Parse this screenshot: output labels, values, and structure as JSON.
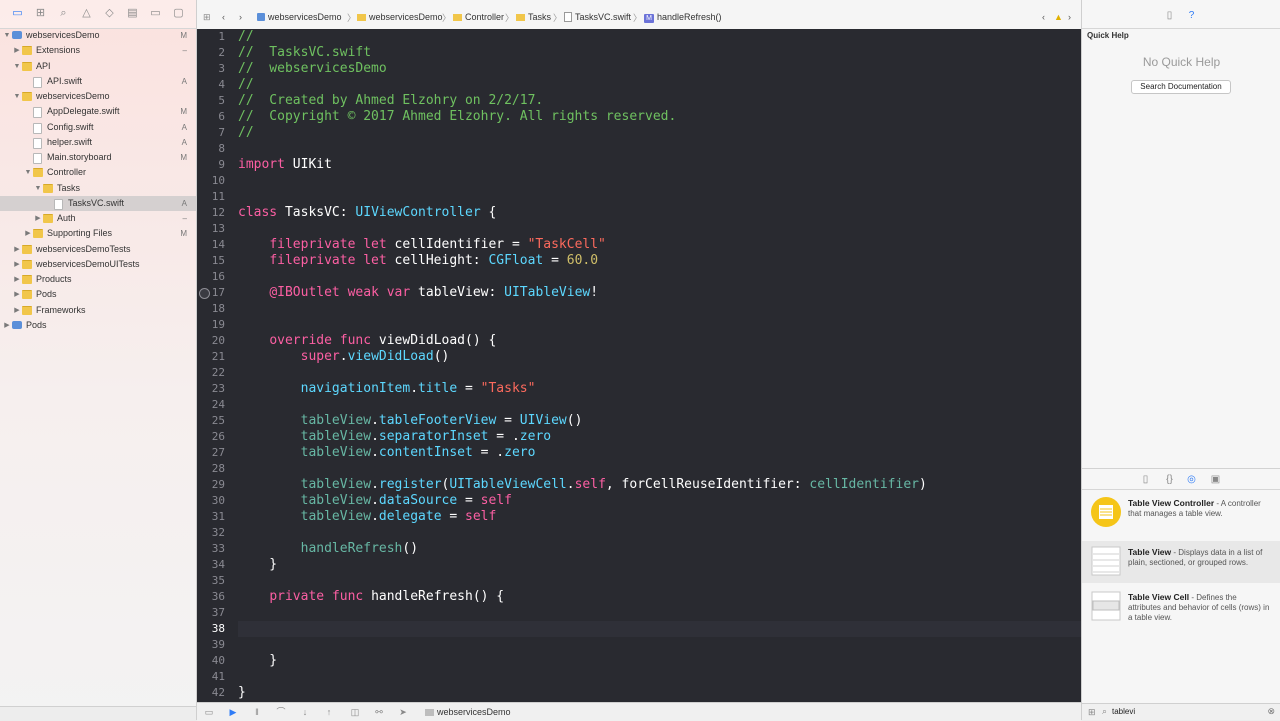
{
  "navigator": {
    "items": [
      {
        "label": "webservicesDemo",
        "level": 0,
        "expanded": true,
        "icon": "project",
        "status": "M"
      },
      {
        "label": "Extensions",
        "level": 1,
        "expanded": false,
        "icon": "folder",
        "status": "–"
      },
      {
        "label": "API",
        "level": 1,
        "expanded": true,
        "icon": "folder",
        "status": ""
      },
      {
        "label": "API.swift",
        "level": 2,
        "expanded": null,
        "icon": "file",
        "status": "A"
      },
      {
        "label": "webservicesDemo",
        "level": 1,
        "expanded": true,
        "icon": "folder",
        "status": ""
      },
      {
        "label": "AppDelegate.swift",
        "level": 2,
        "expanded": null,
        "icon": "file",
        "status": "M"
      },
      {
        "label": "Config.swift",
        "level": 2,
        "expanded": null,
        "icon": "file",
        "status": "A"
      },
      {
        "label": "helper.swift",
        "level": 2,
        "expanded": null,
        "icon": "file",
        "status": "A"
      },
      {
        "label": "Main.storyboard",
        "level": 2,
        "expanded": null,
        "icon": "file",
        "status": "M"
      },
      {
        "label": "Controller",
        "level": 2,
        "expanded": true,
        "icon": "folder",
        "status": ""
      },
      {
        "label": "Tasks",
        "level": 3,
        "expanded": true,
        "icon": "folder",
        "status": ""
      },
      {
        "label": "TasksVC.swift",
        "level": 4,
        "expanded": null,
        "icon": "file",
        "status": "A",
        "selected": true
      },
      {
        "label": "Auth",
        "level": 3,
        "expanded": false,
        "icon": "folder",
        "status": "–"
      },
      {
        "label": "Supporting Files",
        "level": 2,
        "expanded": false,
        "icon": "folder",
        "status": "M"
      },
      {
        "label": "webservicesDemoTests",
        "level": 1,
        "expanded": false,
        "icon": "folder",
        "status": ""
      },
      {
        "label": "webservicesDemoUITests",
        "level": 1,
        "expanded": false,
        "icon": "folder",
        "status": ""
      },
      {
        "label": "Products",
        "level": 1,
        "expanded": false,
        "icon": "folder",
        "status": ""
      },
      {
        "label": "Pods",
        "level": 1,
        "expanded": false,
        "icon": "folder",
        "status": ""
      },
      {
        "label": "Frameworks",
        "level": 1,
        "expanded": false,
        "icon": "folder",
        "status": ""
      },
      {
        "label": "Pods",
        "level": 0,
        "expanded": false,
        "icon": "project",
        "status": ""
      }
    ]
  },
  "jumpbar": {
    "crumbs": [
      "webservicesDemo",
      "webservicesDemo",
      "Controller",
      "Tasks",
      "TasksVC.swift",
      "handleRefresh()"
    ]
  },
  "editor": {
    "current_line": 38,
    "breakpoint_line": 17,
    "lines": [
      [
        [
          "//",
          "comment"
        ]
      ],
      [
        [
          "//  TasksVC.swift",
          "comment"
        ]
      ],
      [
        [
          "//  webservicesDemo",
          "comment"
        ]
      ],
      [
        [
          "//",
          "comment"
        ]
      ],
      [
        [
          "//  Created by Ahmed Elzohry on 2/2/17.",
          "comment"
        ]
      ],
      [
        [
          "//  Copyright © 2017 Ahmed Elzohry. All rights reserved.",
          "comment"
        ]
      ],
      [
        [
          "//",
          "comment"
        ]
      ],
      [],
      [
        [
          "import",
          "kw"
        ],
        [
          " UIKit",
          "plain"
        ]
      ],
      [],
      [],
      [
        [
          "class",
          "kw"
        ],
        [
          " TasksVC: ",
          "plain"
        ],
        [
          "UIViewController",
          "type"
        ],
        [
          " {",
          "plain"
        ]
      ],
      [],
      [
        [
          "    ",
          "plain"
        ],
        [
          "fileprivate",
          "kw"
        ],
        [
          " ",
          "plain"
        ],
        [
          "let",
          "kw"
        ],
        [
          " cellIdentifier = ",
          "plain"
        ],
        [
          "\"TaskCell\"",
          "str"
        ]
      ],
      [
        [
          "    ",
          "plain"
        ],
        [
          "fileprivate",
          "kw"
        ],
        [
          " ",
          "plain"
        ],
        [
          "let",
          "kw"
        ],
        [
          " cellHeight: ",
          "plain"
        ],
        [
          "CGFloat",
          "type"
        ],
        [
          " = ",
          "plain"
        ],
        [
          "60.0",
          "num"
        ]
      ],
      [],
      [
        [
          "    ",
          "plain"
        ],
        [
          "@IBOutlet",
          "kw"
        ],
        [
          " ",
          "plain"
        ],
        [
          "weak",
          "kw"
        ],
        [
          " ",
          "plain"
        ],
        [
          "var",
          "kw"
        ],
        [
          " tableView: ",
          "plain"
        ],
        [
          "UITableView",
          "type"
        ],
        [
          "!",
          "plain"
        ]
      ],
      [],
      [],
      [
        [
          "    ",
          "plain"
        ],
        [
          "override",
          "kw"
        ],
        [
          " ",
          "plain"
        ],
        [
          "func",
          "kw"
        ],
        [
          " viewDidLoad() {",
          "plain"
        ]
      ],
      [
        [
          "        ",
          "plain"
        ],
        [
          "super",
          "kw"
        ],
        [
          ".",
          "plain"
        ],
        [
          "viewDidLoad",
          "type"
        ],
        [
          "()",
          "plain"
        ]
      ],
      [],
      [
        [
          "        ",
          "plain"
        ],
        [
          "navigationItem",
          "type"
        ],
        [
          ".",
          "plain"
        ],
        [
          "title",
          "type"
        ],
        [
          " = ",
          "plain"
        ],
        [
          "\"Tasks\"",
          "str"
        ]
      ],
      [],
      [
        [
          "        ",
          "plain"
        ],
        [
          "tableView",
          "prop"
        ],
        [
          ".",
          "plain"
        ],
        [
          "tableFooterView",
          "type"
        ],
        [
          " = ",
          "plain"
        ],
        [
          "UIView",
          "type"
        ],
        [
          "()",
          "plain"
        ]
      ],
      [
        [
          "        ",
          "plain"
        ],
        [
          "tableView",
          "prop"
        ],
        [
          ".",
          "plain"
        ],
        [
          "separatorInset",
          "type"
        ],
        [
          " = .",
          "plain"
        ],
        [
          "zero",
          "type"
        ]
      ],
      [
        [
          "        ",
          "plain"
        ],
        [
          "tableView",
          "prop"
        ],
        [
          ".",
          "plain"
        ],
        [
          "contentInset",
          "type"
        ],
        [
          " = .",
          "plain"
        ],
        [
          "zero",
          "type"
        ]
      ],
      [],
      [
        [
          "        ",
          "plain"
        ],
        [
          "tableView",
          "prop"
        ],
        [
          ".",
          "plain"
        ],
        [
          "register",
          "type"
        ],
        [
          "(",
          "plain"
        ],
        [
          "UITableViewCell",
          "type"
        ],
        [
          ".",
          "plain"
        ],
        [
          "self",
          "kw"
        ],
        [
          ", forCellReuseIdentifier: ",
          "plain"
        ],
        [
          "cellIdentifier",
          "prop"
        ],
        [
          ")",
          "plain"
        ]
      ],
      [
        [
          "        ",
          "plain"
        ],
        [
          "tableView",
          "prop"
        ],
        [
          ".",
          "plain"
        ],
        [
          "dataSource",
          "type"
        ],
        [
          " = ",
          "plain"
        ],
        [
          "self",
          "kw"
        ]
      ],
      [
        [
          "        ",
          "plain"
        ],
        [
          "tableView",
          "prop"
        ],
        [
          ".",
          "plain"
        ],
        [
          "delegate",
          "type"
        ],
        [
          " = ",
          "plain"
        ],
        [
          "self",
          "kw"
        ]
      ],
      [],
      [
        [
          "        ",
          "plain"
        ],
        [
          "handleRefresh",
          "prop"
        ],
        [
          "()",
          "plain"
        ]
      ],
      [
        [
          "    }",
          "plain"
        ]
      ],
      [],
      [
        [
          "    ",
          "plain"
        ],
        [
          "private",
          "kw"
        ],
        [
          " ",
          "plain"
        ],
        [
          "func",
          "kw"
        ],
        [
          " handleRefresh() {",
          "plain"
        ]
      ],
      [],
      [],
      [],
      [
        [
          "    }",
          "plain"
        ]
      ],
      [],
      [
        [
          "}",
          "plain"
        ]
      ]
    ]
  },
  "debugbar": {
    "target_label": "webservicesDemo"
  },
  "inspector": {
    "quick_help_title": "Quick Help",
    "no_quick_help": "No Quick Help",
    "search_documentation": "Search Documentation",
    "library": [
      {
        "title": "Table View Controller",
        "desc": " - A controller that manages a table view.",
        "icon": "table-view-controller-icon"
      },
      {
        "title": "Table View",
        "desc": " - Displays data in a list of plain, sectioned, or grouped rows.",
        "icon": "table-view-icon"
      },
      {
        "title": "Table View Cell",
        "desc": " - Defines the attributes and behavior of cells (rows) in a table view.",
        "icon": "table-view-cell-icon"
      }
    ],
    "filter_value": "tablevi"
  },
  "colors": {
    "editor_bg": "#292a30",
    "comment": "#6fc160",
    "keyword": "#fc5fa3",
    "type": "#5dd8ff",
    "string": "#fc6a5d",
    "number": "#d0bf69"
  }
}
